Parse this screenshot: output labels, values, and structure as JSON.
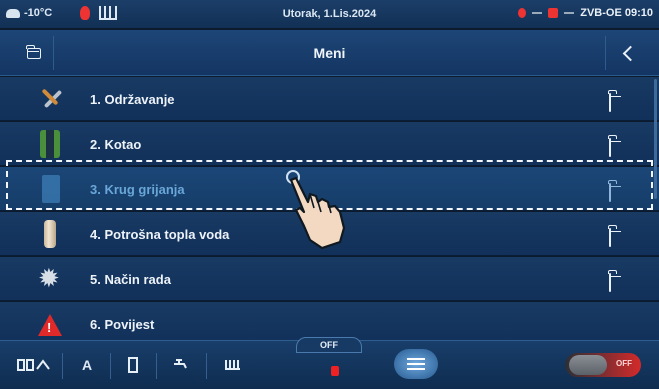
{
  "status": {
    "temperature": "-10°C",
    "date": "Utorak, 1.Lis.2024",
    "device_time": "ZVB-OE  09:10"
  },
  "header": {
    "title": "Meni"
  },
  "menu": {
    "items": [
      {
        "label": "1. Održavanje",
        "icon": "tools-icon"
      },
      {
        "label": "2. Kotao",
        "icon": "boiler-icon"
      },
      {
        "label": "3. Krug grijanja",
        "icon": "heating-circuit-icon",
        "selected": true
      },
      {
        "label": "4. Potrošna topla voda",
        "icon": "water-tank-icon"
      },
      {
        "label": "5. Način rada",
        "icon": "gear-icon"
      },
      {
        "label": "6. Povijest",
        "icon": "warning-icon"
      }
    ]
  },
  "bottombar": {
    "mode_tab": "OFF",
    "auto_label": "A",
    "toggle_label": "OFF"
  },
  "colors": {
    "background": "#0b1a2c",
    "row": "#183a63",
    "selected_text": "#69a7d8",
    "accent_red": "#e22a2a"
  }
}
